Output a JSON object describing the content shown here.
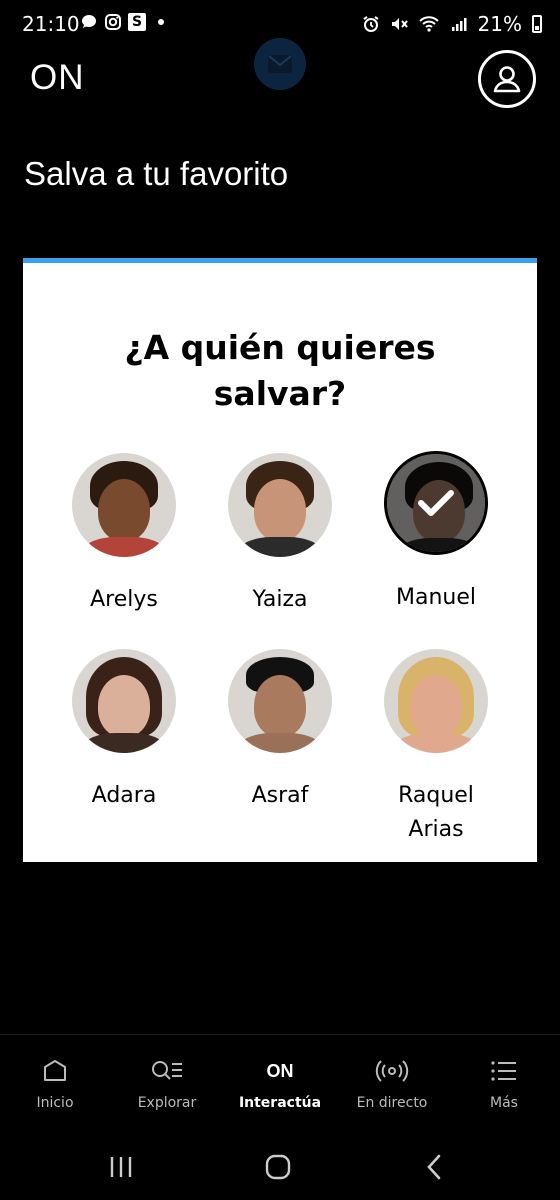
{
  "status_bar": {
    "time": "21:10",
    "battery": "21%"
  },
  "header": {
    "logo": "ON"
  },
  "page_title": "Salva a tu favorito",
  "card": {
    "question": "¿A quién quieres salvar?",
    "accent_color": "#3aa0f0",
    "candidates": [
      {
        "name": "Arelys",
        "selected": false
      },
      {
        "name": "Yaiza",
        "selected": false
      },
      {
        "name": "Manuel",
        "selected": true
      },
      {
        "name": "Adara",
        "selected": false
      },
      {
        "name": "Asraf",
        "selected": false
      },
      {
        "name": "Raquel Arias",
        "selected": false
      }
    ]
  },
  "bottom_nav": {
    "items": [
      {
        "label": "Inicio",
        "icon": "home-icon"
      },
      {
        "label": "Explorar",
        "icon": "explore-icon"
      },
      {
        "label": "Interactúa",
        "icon": "on-icon",
        "icon_text": "ON",
        "active": true
      },
      {
        "label": "En directo",
        "icon": "live-icon"
      },
      {
        "label": "Más",
        "icon": "menu-icon"
      }
    ]
  }
}
